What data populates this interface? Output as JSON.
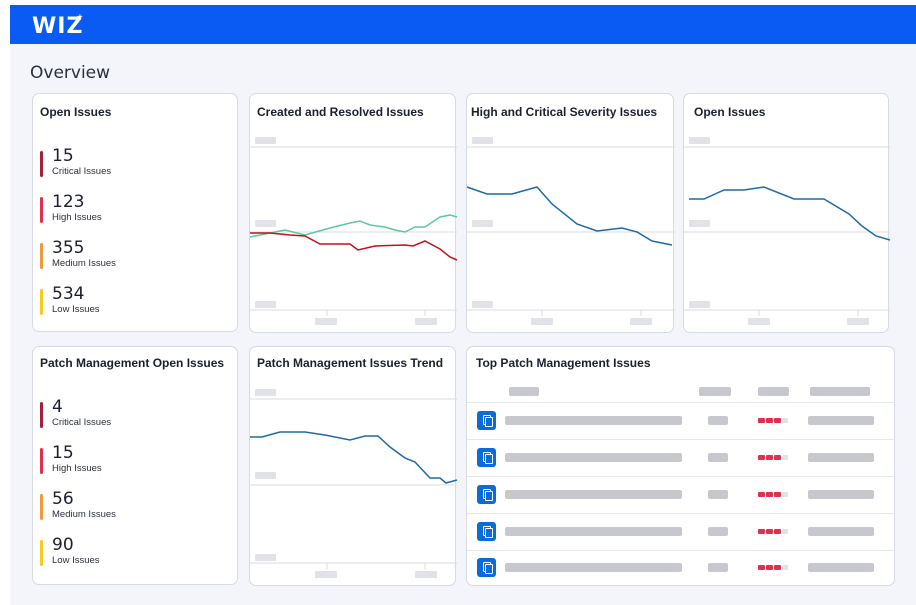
{
  "app": {
    "logo_text": "WIZ",
    "logo_mark": "+"
  },
  "page": {
    "title": "Overview"
  },
  "cards": {
    "open_issues": {
      "title": "Open Issues",
      "stats": [
        {
          "value": "15",
          "label": "Critical Issues",
          "color": "#a3203b"
        },
        {
          "value": "123",
          "label": "High Issues",
          "color": "#e0304f"
        },
        {
          "value": "355",
          "label": "Medium Issues",
          "color": "#f09a3e"
        },
        {
          "value": "534",
          "label": "Low Issues",
          "color": "#f7cb1f"
        }
      ]
    },
    "created_resolved": {
      "title": "Created and Resolved Issues"
    },
    "high_critical": {
      "title": "High and Critical Severity Issues"
    },
    "open_issues_trend": {
      "title": "Open Issues"
    },
    "patch_open": {
      "title": "Patch Management Open Issues",
      "stats": [
        {
          "value": "4",
          "label": "Critical Issues",
          "color": "#a3203b"
        },
        {
          "value": "15",
          "label": "High Issues",
          "color": "#e0304f"
        },
        {
          "value": "56",
          "label": "Medium Issues",
          "color": "#f09a3e"
        },
        {
          "value": "90",
          "label": "Low Issues",
          "color": "#f7cb1f"
        }
      ]
    },
    "patch_trend": {
      "title": "Patch Management Issues Trend"
    },
    "top_patch": {
      "title": "Top Patch Management Issues",
      "row_icon": "copy-icon",
      "severity_color": "#e0304f"
    }
  },
  "colors": {
    "brand": "#0a5bf3",
    "line_blue": "#1f6aa5",
    "line_red": "#c0121a",
    "line_green": "#5cc7a2"
  }
}
